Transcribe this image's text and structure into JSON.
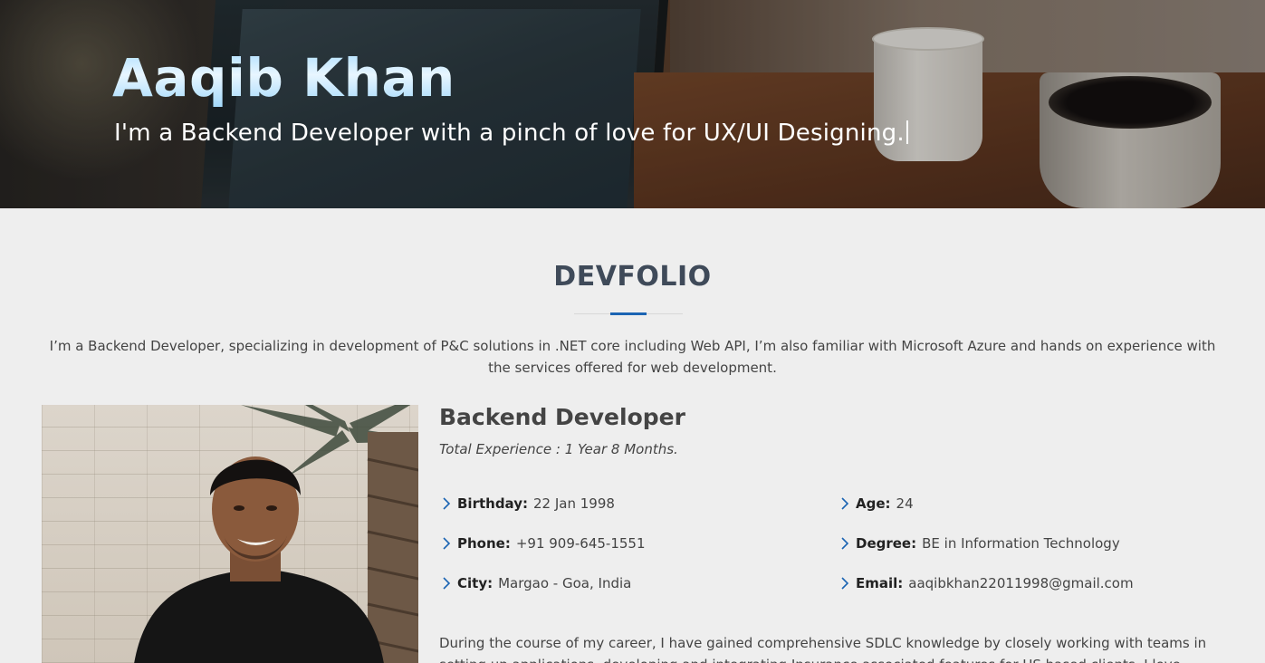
{
  "hero": {
    "name": "Aaqib Khan",
    "tagline": "I'm a Backend Developer with a pinch of love for UX/UI Designing."
  },
  "about": {
    "section_title": "DEVFOLIO",
    "intro": "I’m a Backend Developer, specializing in development of P&C solutions in .NET core including Web API, I’m also familiar with Microsoft Azure and hands on experience with the services offered for web development.",
    "role": "Backend Developer",
    "experience": "Total Experience : 1 Year 8 Months.",
    "details": {
      "birthday": {
        "label": "Birthday:",
        "value": "22 Jan 1998"
      },
      "age": {
        "label": "Age:",
        "value": "24"
      },
      "phone": {
        "label": "Phone:",
        "value": "+91 909-645-1551"
      },
      "degree": {
        "label": "Degree:",
        "value": "BE in Information Technology"
      },
      "city": {
        "label": "City:",
        "value": "Margao - Goa, India"
      },
      "email": {
        "label": "Email:",
        "value": "aaqibkhan22011998@gmail.com"
      }
    },
    "bio": "During the course of my career, I have gained comprehensive SDLC knowledge by closely working with teams in setting up applications, developing and integrating Insurance associated features for US based clients. I love"
  },
  "colors": {
    "accent": "#1b64b3",
    "title": "#3f4a59",
    "background": "#eeeeee",
    "chevron": "#1b64b3"
  },
  "icons": {
    "detail_bullet": "chevron-right-icon"
  }
}
